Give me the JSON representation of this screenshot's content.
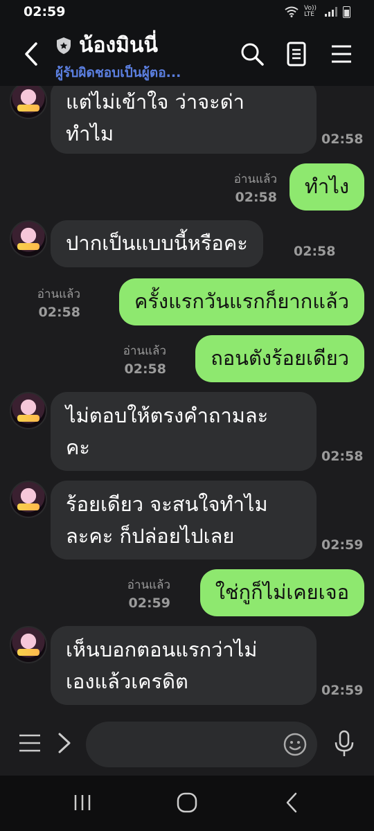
{
  "status_bar": {
    "time": "02:59",
    "network": "Vo)) LTE"
  },
  "header": {
    "title": "น้องมินนี่",
    "subtitle": "ผู้รับผิดชอบเป็นผู้ตอ..."
  },
  "messages": [
    {
      "dir": "in",
      "lines": "แต่ไม่เข้าใจ ว่าจะด่า\nทำไม",
      "time": "02:58"
    },
    {
      "dir": "out",
      "text": "ทำไง",
      "read": "อ่านแล้ว",
      "time": "02:58"
    },
    {
      "dir": "in",
      "text": "ปากเป็นแบบนี้หรือคะ",
      "time": "02:58"
    },
    {
      "dir": "out",
      "text": "ครั้งแรกวันแรกก็ยากแล้ว",
      "read": "อ่านแล้ว",
      "time": "02:58"
    },
    {
      "dir": "out",
      "text": "ถอนตังร้อยเดียว",
      "read": "อ่านแล้ว",
      "time": "02:58"
    },
    {
      "dir": "in",
      "lines": "ไม่ตอบให้ตรงคำถามละ\nคะ",
      "time": "02:58"
    },
    {
      "dir": "in",
      "lines": "ร้อยเดียว จะสนใจทำไม\nละคะ ก็ปล่อยไปเลย",
      "time": "02:59"
    },
    {
      "dir": "out",
      "text": "ใช่กูก็ไม่เคยเจอ",
      "read": "อ่านแล้ว",
      "time": "02:59"
    },
    {
      "dir": "in",
      "lines": "เห็นบอกตอนแรกว่าไม่\nเองแล้วเครดิต",
      "time": "02:59"
    }
  ],
  "colors": {
    "outgoing_bubble": "#8ee86f",
    "incoming_bubble": "#2e2f31",
    "subtitle": "#5b7fe0"
  }
}
